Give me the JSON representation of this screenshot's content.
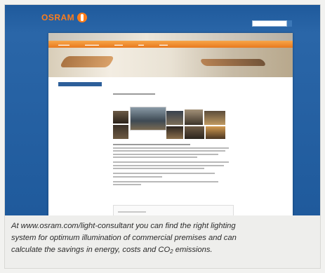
{
  "site": {
    "logo_text": "OSRAM",
    "brand_color": "#ff7d1a",
    "header_color": "#1f5a9c",
    "nav_color": "#e8791e"
  },
  "caption": {
    "line1": "At www.osram.com/light-consultant you can find the right lighting",
    "line2": "system for optimum illumination of commercial premises and can",
    "line3_pre": "calculate the savings in energy, costs and CO",
    "line3_sub": "2",
    "line3_post": " emissions."
  }
}
